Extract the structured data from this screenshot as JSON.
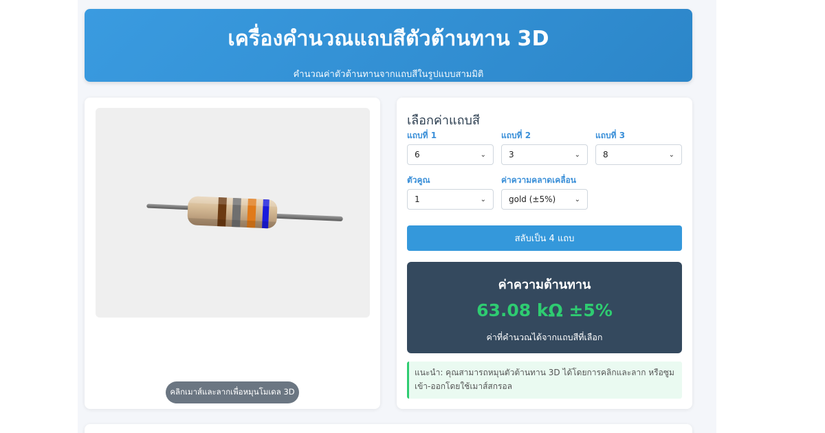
{
  "header": {
    "title": "เครื่องคำนวณแถบสีตัวต้านทาน 3D",
    "subtitle": "คำนวณค่าตัวต้านทานจากแถบสีในรูปแบบสามมิติ"
  },
  "viewer": {
    "hint": "คลิกเมาส์และลากเพื่อหมุนโมเดล 3D",
    "band_colors": [
      "#6b3a12",
      "#6f6f6f",
      "#e07a1a",
      "#1a1adc"
    ],
    "body_color": "#d4b896"
  },
  "controls": {
    "heading": "เลือกค่าแถบสี",
    "band1": {
      "label": "แถบที่ 1",
      "value": "6"
    },
    "band2": {
      "label": "แถบที่ 2",
      "value": "3"
    },
    "band3": {
      "label": "แถบที่ 3",
      "value": "8"
    },
    "multiplier": {
      "label": "ตัวคูณ",
      "value": "1"
    },
    "tolerance": {
      "label": "ค่าความคลาดเคลื่อน",
      "value": "gold (±5%)"
    },
    "toggle_button": "สลับเป็น 4 แถบ"
  },
  "result": {
    "title": "ค่าความต้านทาน",
    "value": "63.08 kΩ ±5%",
    "note": "ค่าที่คำนวณได้จากแถบสีที่เลือก"
  },
  "tip": "แนะนำ: คุณสามารถหมุนตัวต้านทาน 3D ได้โดยการคลิกและลาก หรือซูมเข้า-ออกโดยใช้เมาส์สกรอล"
}
